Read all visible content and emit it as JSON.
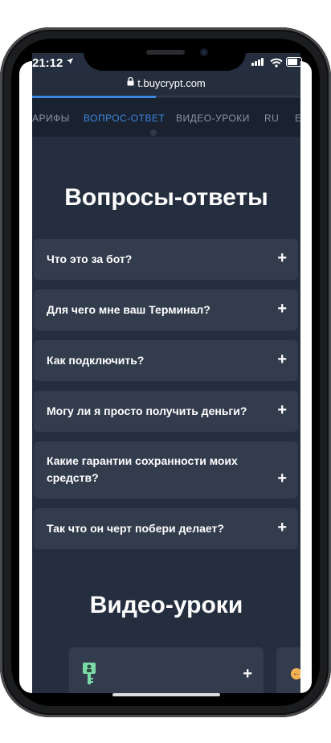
{
  "status_bar": {
    "time": "21:12"
  },
  "browser": {
    "url": "t.buycrypt.com"
  },
  "nav": {
    "items": [
      "АРИФЫ",
      "ВОПРОС-ОТВЕТ",
      "ВИДЕО-УРОКИ",
      "RU",
      "E"
    ],
    "active_index": 1,
    "load_progress": 0.46
  },
  "faq": {
    "title": "Вопросы-ответы",
    "items": [
      {
        "question": "Что это за бот?"
      },
      {
        "question": "Для чего мне ваш Терминал?"
      },
      {
        "question": "Как подключить?"
      },
      {
        "question": "Могу ли я просто получить деньги?"
      },
      {
        "question": "Какие гарантии сохранности моих средств?"
      },
      {
        "question": "Так что он черт побери делает?"
      }
    ],
    "expand_symbol": "+"
  },
  "videos": {
    "title": "Видео-уроки",
    "expand_symbol": "+",
    "coin_symbol": "←"
  },
  "colors": {
    "page_bg": "#242e3e",
    "card_bg": "#323c4d",
    "accent": "#3b86e3",
    "nav_bg": "#1a222f"
  }
}
